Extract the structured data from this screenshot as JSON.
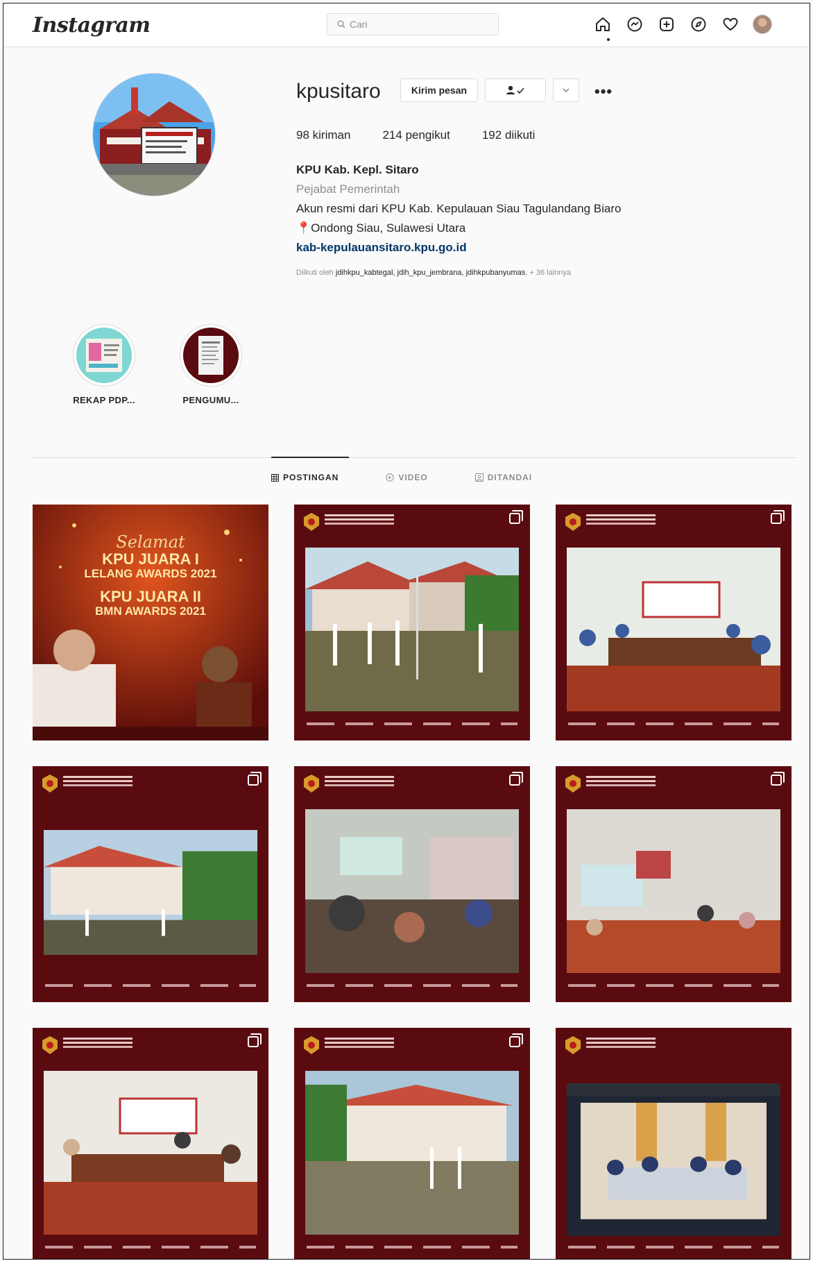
{
  "nav": {
    "logo": "Instagram",
    "search_placeholder": "Cari",
    "icons": [
      "home-icon",
      "messenger-icon",
      "new-post-icon",
      "explore-icon",
      "activity-heart-icon",
      "profile-avatar"
    ]
  },
  "profile": {
    "username": "kpusitaro",
    "message_button": "Kirim pesan",
    "stats": {
      "posts": "98",
      "posts_label": "kiriman",
      "followers": "214",
      "followers_label": "pengikut",
      "following": "192",
      "following_label": "diikuti"
    },
    "name": "KPU Kab. Kepl. Sitaro",
    "category": "Pejabat Pemerintah",
    "bio_line": "Akun resmi dari KPU Kab. Kepulauan Siau Tagulandang Biaro",
    "location_line": "Ondong Siau, Sulawesi Utara",
    "website": "kab-kepulauansitaro.kpu.go.id",
    "followed_by_prefix": "Diikuti oleh",
    "followed_by_names": "jdihkpu_kabtegal, jdih_kpu_jembrana, jdihkpubanyumas",
    "followed_by_suffix": "+ 36 lainnya"
  },
  "highlights": [
    {
      "label": "REKAP PDP..."
    },
    {
      "label": "PENGUMU..."
    }
  ],
  "tabs": [
    {
      "label": "POSTINGAN",
      "icon": "grid-icon",
      "active": true
    },
    {
      "label": "VIDEO",
      "icon": "video-icon",
      "active": false
    },
    {
      "label": "DITANDAI",
      "icon": "tagged-icon",
      "active": false
    }
  ],
  "first_post": {
    "line1": "Selamat",
    "line2": "KPU JUARA I",
    "line3": "LELANG AWARDS 2021",
    "line4": "KPU JUARA II",
    "line5": "BMN AWARDS 2021"
  },
  "colors": {
    "kpu_maroon": "#5a0b10",
    "link": "#00376b",
    "muted": "#8e8e8e"
  }
}
